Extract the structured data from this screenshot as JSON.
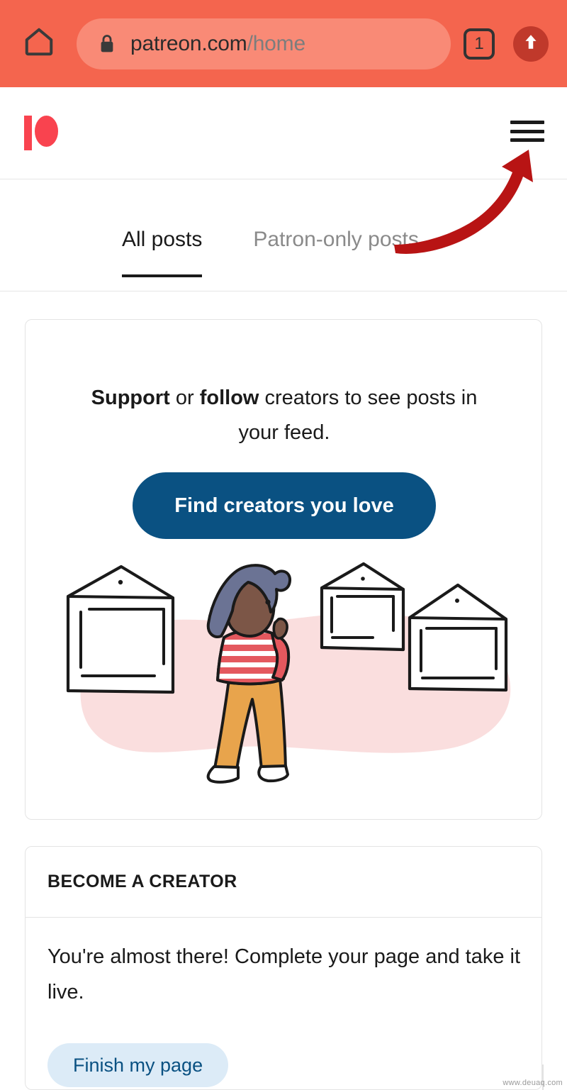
{
  "browser": {
    "home_icon": "home-icon",
    "lock_icon": "lock-icon",
    "url_domain": "patreon.com",
    "url_path": "/home",
    "tab_count": "1",
    "share_icon": "upload-arrow-icon",
    "toolbar_color": "#F4654E",
    "url_pill_color": "#F98A76"
  },
  "site_header": {
    "logo_name": "patreon-logo",
    "logo_color": "#F9434F",
    "menu_icon": "hamburger-menu-icon"
  },
  "tabs": [
    {
      "label": "All posts",
      "active": true
    },
    {
      "label": "Patron-only posts",
      "active": false
    }
  ],
  "feed_card": {
    "message_part1": "Support",
    "message_part2": " or ",
    "message_part3": "follow",
    "message_part4": " creators to see posts in your feed.",
    "cta_label": "Find creators you love",
    "cta_color": "#0A5182",
    "illustration_name": "person-viewing-art-frames-illustration",
    "illustration_colors": {
      "blob": "#FADEDE",
      "hair": "#6B7394",
      "skin": "#7C5647",
      "shirt_stripe": "#E4585E",
      "pants": "#E8A44C",
      "outline": "#1A1A1A"
    }
  },
  "creator_card": {
    "section_title": "BECOME A CREATOR",
    "body_text": "You're almost there! Complete your page and take it live.",
    "cta_label": "Finish my page",
    "cta_bg": "#DCEBF7",
    "cta_text_color": "#0A5182"
  },
  "annotation": {
    "arrow_name": "red-curved-arrow-pointing-to-menu",
    "arrow_color": "#B81414"
  },
  "watermark": {
    "text": "www.deuaq.com"
  }
}
